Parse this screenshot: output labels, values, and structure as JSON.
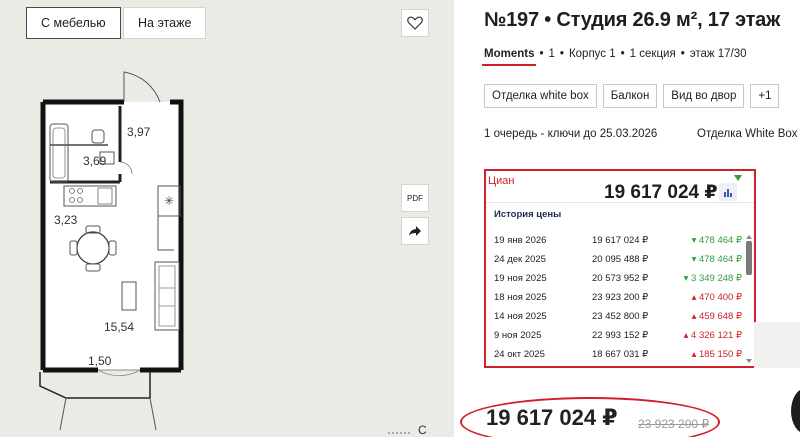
{
  "tabs": [
    {
      "label": "С мебелью",
      "active": true
    },
    {
      "label": "На этаже",
      "active": false
    }
  ],
  "plan": {
    "areas": [
      "3,97",
      "3,69",
      "3,23",
      "15,54",
      "1,50"
    ]
  },
  "side_buttons": {
    "pdf_label": "PDF"
  },
  "bottom_char": "С",
  "listing": {
    "title": "№197 • Студия 26.9 м², 17 этаж",
    "breadcrumb": [
      "Moments",
      "1",
      "Корпус 1",
      "1 секция",
      "этаж 17/30"
    ],
    "chips": [
      "Отделка white box",
      "Балкон",
      "Вид во двор",
      "+1"
    ],
    "queue_text": "1 очередь - ключи до 25.03.2026",
    "finish_text": "Отделка White Box"
  },
  "cian": {
    "brand": "Циан",
    "price": "19 617 024 ₽",
    "history_title": "История цены",
    "rows": [
      {
        "date": "19 янв 2026",
        "price": "19 617 024 ₽",
        "change": "▾ 478 464 ₽",
        "dir": "down"
      },
      {
        "date": "24 дек 2025",
        "price": "20 095 488 ₽",
        "change": "▾ 478 464 ₽",
        "dir": "down"
      },
      {
        "date": "19 ноя 2025",
        "price": "20 573 952 ₽",
        "change": "▾ 3 349 248 ₽",
        "dir": "down"
      },
      {
        "date": "18 ноя 2025",
        "price": "23 923 200 ₽",
        "change": "▴ 470 400 ₽",
        "dir": "up"
      },
      {
        "date": "14 ноя 2025",
        "price": "23 452 800 ₽",
        "change": "▴ 459 648 ₽",
        "dir": "up"
      },
      {
        "date": "9 ноя 2025",
        "price": "22 993 152 ₽",
        "change": "▴ 4 326 121 ₽",
        "dir": "up"
      },
      {
        "date": "24 окт 2025",
        "price": "18 667 031 ₽",
        "change": "▴ 185 150 ₽",
        "dir": "up"
      }
    ]
  },
  "final": {
    "price": "19 617 024 ₽",
    "old_price": "23 923 200 ₽"
  },
  "colors": {
    "accent_red": "#d0202a",
    "down_green": "#2e9e3e",
    "left_bg": "#ebebe6"
  }
}
